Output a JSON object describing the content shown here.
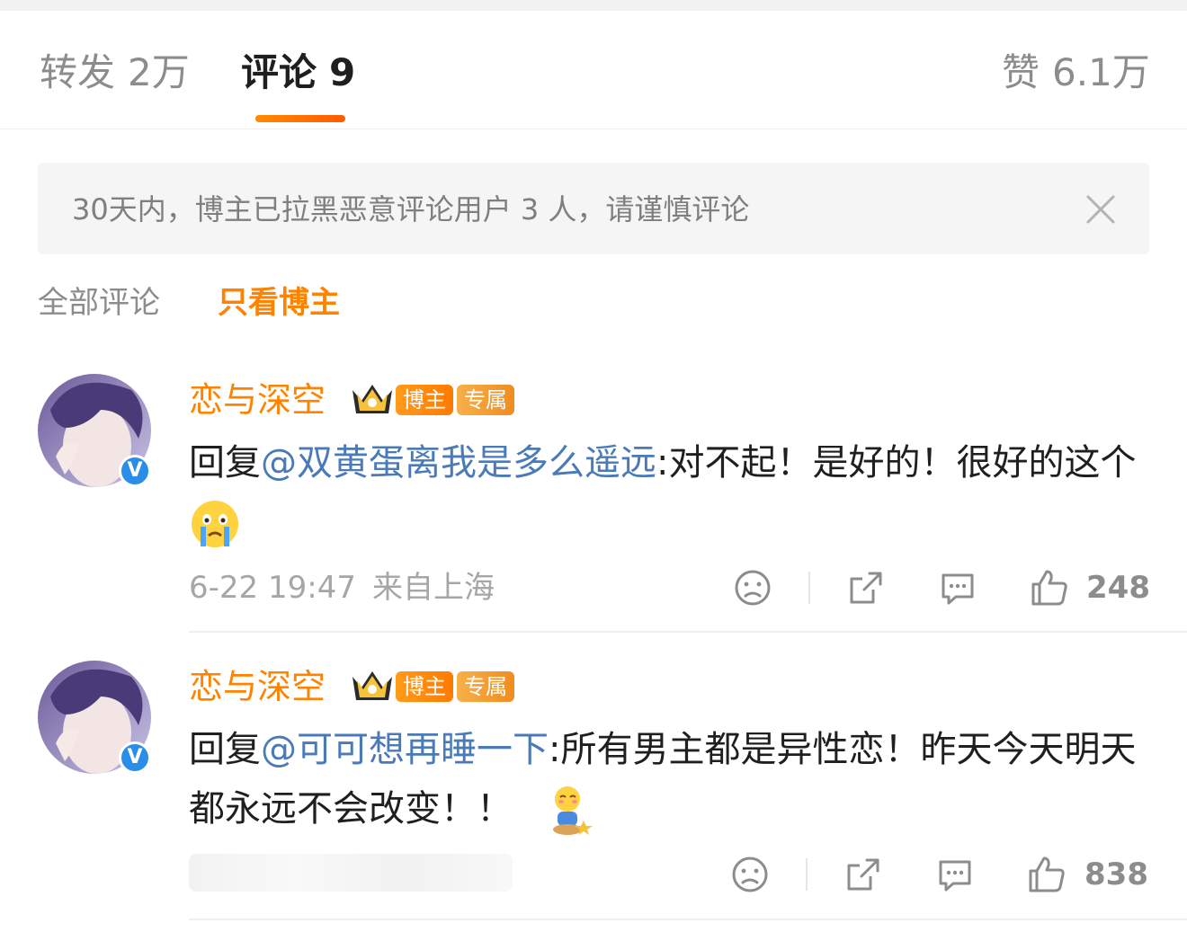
{
  "tabs": {
    "repost_label": "转发",
    "repost_count": "2万",
    "comment_label": "评论",
    "comment_count": "9",
    "like_label": "赞",
    "like_count": "6.1万",
    "active": "comment"
  },
  "notice": {
    "text": "30天内，博主已拉黑恶意评论用户 3 人，请谨慎评论",
    "close_icon": "close-icon"
  },
  "filters": {
    "all_label": "全部评论",
    "owner_only_label": "只看博主",
    "active": "owner_only"
  },
  "badges": {
    "owner": "博主",
    "exclusive": "专属"
  },
  "comments": [
    {
      "user": "恋与深空",
      "reply_prefix": "回复",
      "mention": "@双黄蛋离我是多么遥远",
      "separator": ":",
      "text": "对不起！是好的！很好的这个",
      "emoji": "crying-emoji",
      "date": "6-22 19:47",
      "location": "来自上海",
      "likes": "248"
    },
    {
      "user": "恋与深空",
      "reply_prefix": "回复",
      "mention": "@可可想再睡一下",
      "separator": ":",
      "text": "所有男主都是异性恋！昨天今天明天都永远不会改变！！",
      "emoji": "shy-sitting-emoji",
      "likes": "838"
    }
  ],
  "colors": {
    "accent": "#ff8200",
    "mention": "#4a7ab8",
    "verified": "#2a8de8"
  }
}
